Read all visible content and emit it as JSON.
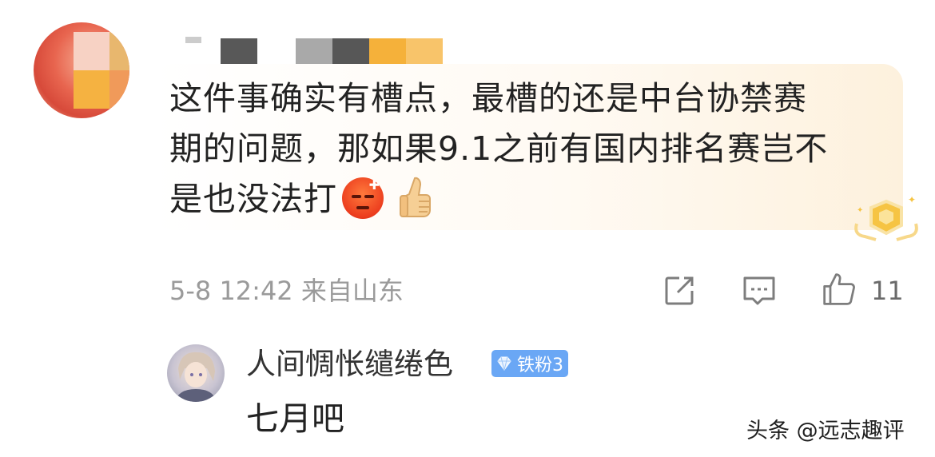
{
  "comment": {
    "text_line1": "这件事确实有槽点，最槽的还是中台协禁赛",
    "text_line2": "期的问题，那如果9.1之前有国内排名赛岂不",
    "text_line3": "是也没法打",
    "emojis": [
      "angry-face-icon",
      "thumbs-up-icon"
    ],
    "timestamp": "5-8 12:42 来自山东",
    "like_count": "11"
  },
  "reply": {
    "username": "人间惆怅缱绻色",
    "badge_label": "铁粉3",
    "text": "七月吧"
  },
  "watermark": {
    "text": "头条 @远志趣评"
  },
  "colors": {
    "meta_gray": "#9a9a9a",
    "badge_blue": "#6aa7f5",
    "bubble_tint": "#fdf1dd"
  }
}
